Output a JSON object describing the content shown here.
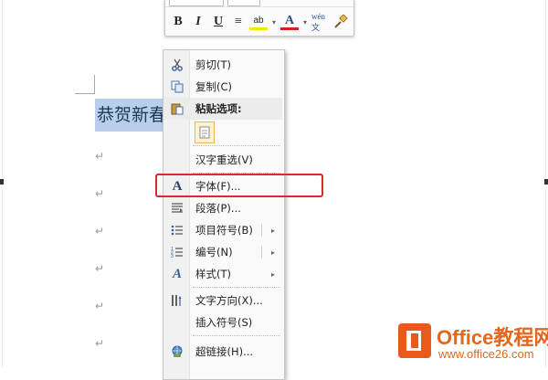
{
  "document": {
    "selected_text": "恭贺新春",
    "paragraph_mark": "↵"
  },
  "mini_toolbar": {
    "buttons": [
      "B",
      "I",
      "U",
      "≡",
      "ab",
      "▾",
      "A",
      "▾",
      "wén 文",
      "brush"
    ]
  },
  "context_menu": {
    "items": [
      {
        "label": "剪切(T)",
        "icon": "scissors-icon"
      },
      {
        "label": "复制(C)",
        "icon": "copy-icon"
      },
      {
        "label": "粘贴选项:",
        "icon": "paste-icon"
      },
      {
        "label": "汉字重选(V)",
        "icon": ""
      },
      {
        "label": "字体(F)...",
        "icon": "font-icon"
      },
      {
        "label": "段落(P)...",
        "icon": "paragraph-icon"
      },
      {
        "label": "项目符号(B)",
        "icon": "bullets-icon",
        "submenu": true
      },
      {
        "label": "编号(N)",
        "icon": "numbering-icon",
        "submenu": true
      },
      {
        "label": "样式(T)",
        "icon": "styles-icon",
        "submenu": true
      },
      {
        "label": "文字方向(X)...",
        "icon": "text-direction-icon"
      },
      {
        "label": "插入符号(S)",
        "icon": ""
      },
      {
        "label": "超链接(H)...",
        "icon": "hyperlink-icon"
      }
    ],
    "submenu_arrow": "▸"
  },
  "watermark": {
    "title": "Office教程网",
    "url": "www.office26.com"
  },
  "colors": {
    "highlight": "#d62c2c",
    "selection": "#b8cee9",
    "brand_orange": "#e6661a"
  }
}
